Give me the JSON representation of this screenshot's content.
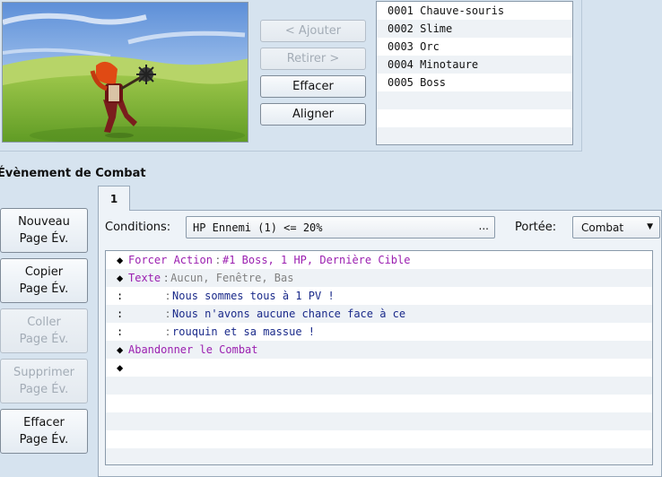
{
  "buttons": {
    "add": "< Ajouter",
    "remove": "Retirer >",
    "clear": "Effacer",
    "align": "Aligner"
  },
  "troop_list": [
    "0001 Chauve-souris",
    "0002 Slime",
    "0003 Orc",
    "0004 Minotaure",
    "0005 Boss"
  ],
  "battle_event": {
    "title": "Évènement de Combat",
    "page_buttons": {
      "new": [
        "Nouveau",
        "Page Év."
      ],
      "copy": [
        "Copier",
        "Page Év."
      ],
      "paste": [
        "Coller",
        "Page Év."
      ],
      "delete": [
        "Supprimer",
        "Page Év."
      ],
      "clear": [
        "Effacer",
        "Page Év."
      ]
    },
    "tab_label": "1",
    "conditions_label": "Conditions:",
    "conditions_value": "HP Ennemi (1) <= 20%",
    "conditions_more": "...",
    "span_label": "Portée:",
    "span_value": "Combat"
  },
  "commands": [
    {
      "marker": "◆",
      "cmd": "Forcer Action",
      "sep": ":",
      "args": "#1 Boss, 1 HP, Dernière Cible",
      "color": "#9b1fb0",
      "argcolor": "#9b1fb0"
    },
    {
      "marker": "◆",
      "cmd": "Texte",
      "sep": ":",
      "args": "Aucun, Fenêtre, Bas",
      "color": "#9b1fb0",
      "argcolor": "#808080"
    },
    {
      "marker": ":",
      "cmd": "",
      "sep": ":",
      "args": "Nous sommes tous à 1 PV !",
      "color": "#000000",
      "argcolor": "#1a2a8a"
    },
    {
      "marker": ":",
      "cmd": "",
      "sep": ":",
      "args": "Nous n'avons aucune chance face à ce",
      "color": "#000000",
      "argcolor": "#1a2a8a"
    },
    {
      "marker": ":",
      "cmd": "",
      "sep": ":",
      "args": "rouquin et sa massue !",
      "color": "#000000",
      "argcolor": "#1a2a8a"
    },
    {
      "marker": "◆",
      "cmd": "Abandonner le Combat",
      "sep": "",
      "args": "",
      "color": "#9b1fb0",
      "argcolor": "#9b1fb0"
    },
    {
      "marker": "◆",
      "cmd": "",
      "sep": "",
      "args": "",
      "color": "#000000",
      "argcolor": "#000000"
    }
  ]
}
